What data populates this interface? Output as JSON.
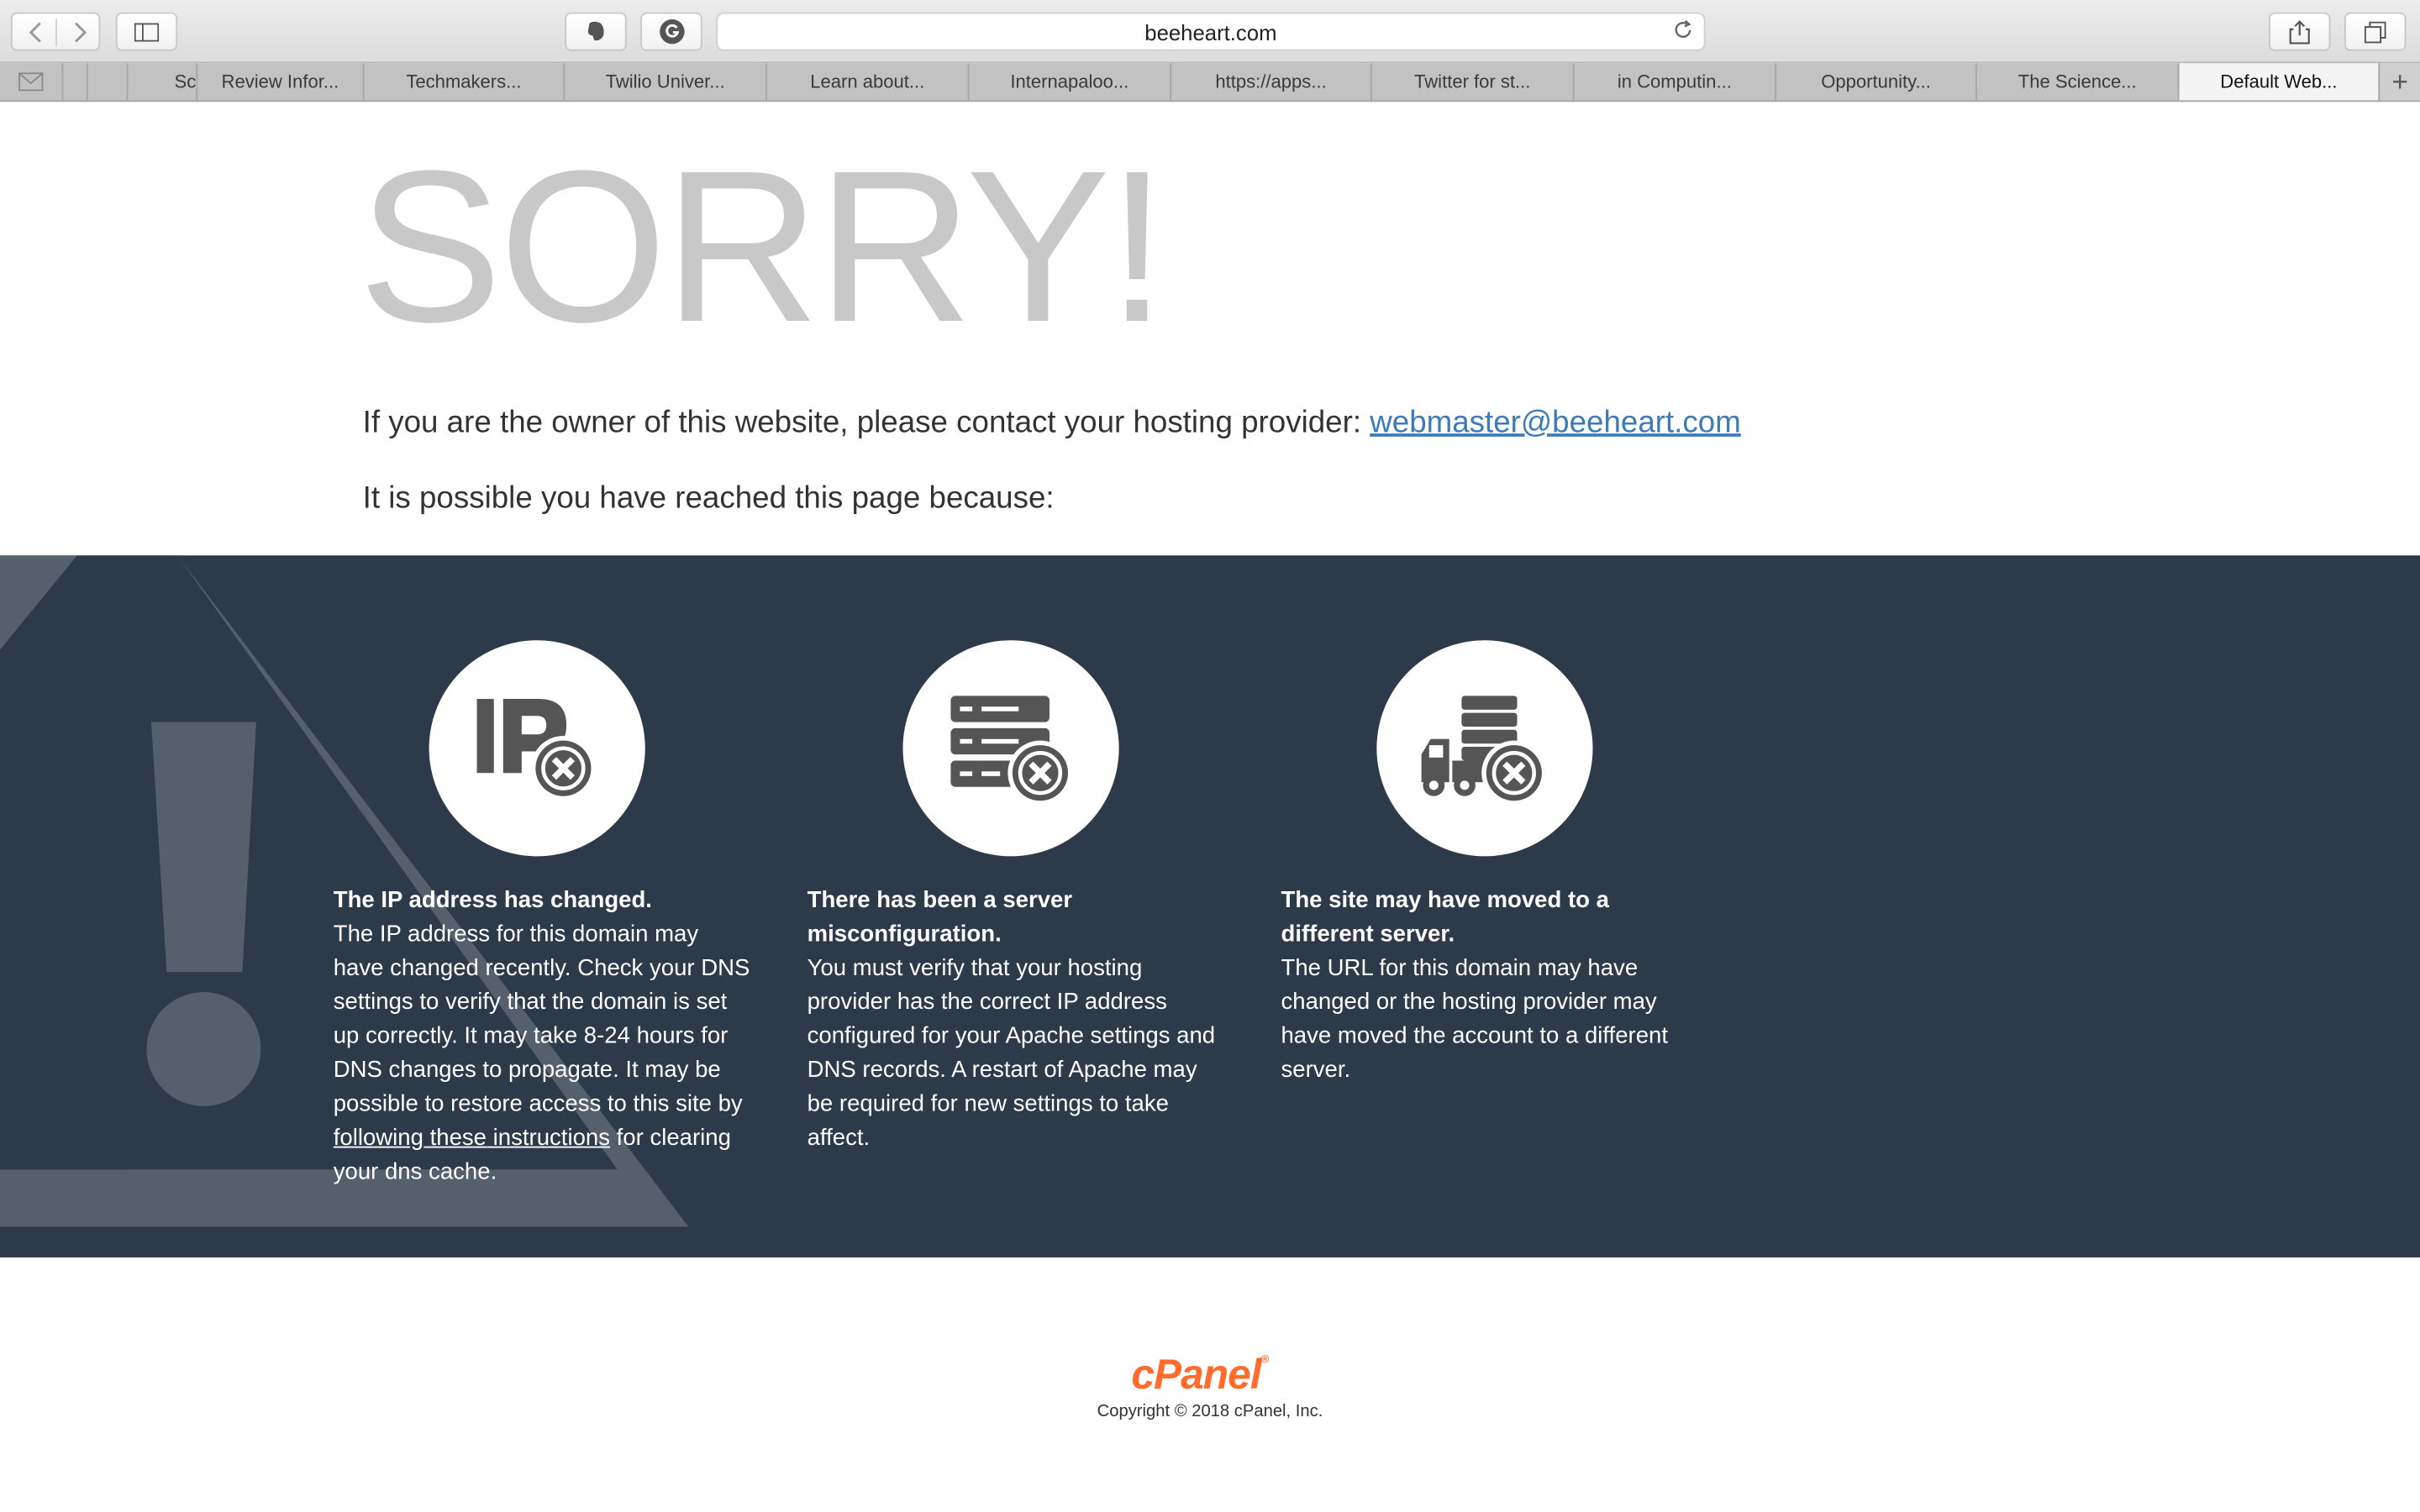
{
  "browser": {
    "url": "beeheart.com",
    "tabs": [
      {
        "label": "Sc",
        "active": false
      },
      {
        "label": "Review Infor...",
        "active": false
      },
      {
        "label": "Techmakers...",
        "active": false
      },
      {
        "label": "Twilio Univer...",
        "active": false
      },
      {
        "label": "Learn about...",
        "active": false
      },
      {
        "label": "Internapaloo...",
        "active": false
      },
      {
        "label": "https://apps...",
        "active": false
      },
      {
        "label": "Twitter for st...",
        "active": false
      },
      {
        "label": "in Computin...",
        "active": false
      },
      {
        "label": "Opportunity...",
        "active": false
      },
      {
        "label": "The Science...",
        "active": false
      },
      {
        "label": "Default Web...",
        "active": true
      }
    ],
    "new_tab_label": "+"
  },
  "page": {
    "headline": "SORRY!",
    "owner_text": "If you are the owner of this website, please contact your hosting provider: ",
    "owner_email": "webmaster@beeheart.com",
    "possible_text": "It is possible you have reached this page because:",
    "reasons": [
      {
        "icon": "ip-error-icon",
        "title": "The IP address has changed.",
        "body": "The IP address for this domain may have changed recently. Check your DNS settings to verify that the domain is set up correctly. It may take 8-24 hours for DNS changes to propagate. It may be possible to restore access to this site by ",
        "link": "following these instructions",
        "body_after": " for clearing your dns cache."
      },
      {
        "icon": "server-error-icon",
        "title": "There has been a server misconfiguration.",
        "body": "You must verify that your hosting provider has the correct IP address configured for your Apache settings and DNS records. A restart of Apache may be required for new settings to take affect."
      },
      {
        "icon": "moved-server-icon",
        "title": "The site may have moved to a different server.",
        "body": "The URL for this domain may have changed or the hosting provider may have moved the account to a different server."
      }
    ],
    "footer": {
      "logo": "cPanel",
      "registered": "®",
      "copyright": "Copyright © 2018 cPanel, Inc."
    }
  },
  "colors": {
    "band": "#2d3a4a",
    "headline": "#c8c8c8",
    "link": "#3d7ab8",
    "logo": "#ff6c2c"
  }
}
